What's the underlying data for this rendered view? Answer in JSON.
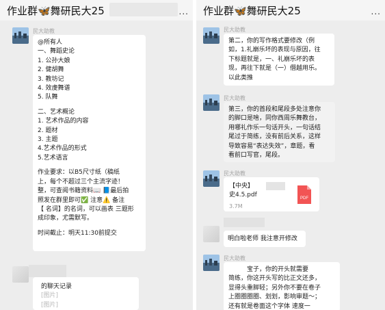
{
  "left": {
    "title": "作业群🦋舞研民大25",
    "more": "...",
    "msg1": {
      "sender": "民大助教",
      "lines": [
        "@所有人",
        "一、舞蹈史论",
        "1. 公孙大娘",
        "2. 健胡舞",
        "3. 教坊记",
        "4. 效虔舞谱",
        "5. 队舞",
        "",
        "二、艺术概论",
        "1. 艺术作品的内容",
        "2. 题材",
        "3. 主题",
        "4.艺术作品的形式",
        "5.艺术语言",
        "",
        "作业要求：以B5尺寸纸（稿纸",
        "上，每个不超过三个主流字迹！",
        "整，可查阅书籍资料📖 📘最后拍",
        "照发在群里即可✅ 注意⚠️ 备注",
        "【 名词】的名词，可以画表 三题形",
        "成印象，尤需默写。",
        "",
        "时间截止：明天11:30前提交"
      ]
    },
    "msg2": {
      "lines": [
        "的聊天记录",
        "[图片]",
        "[图片]"
      ]
    }
  },
  "right": {
    "title": "作业群🦋舞研民大25",
    "more": "...",
    "msg1": {
      "sender": "民大助教",
      "lines": [
        "第二，你的写作格式要修改（例",
        "如，1.礼崩乐坏的表现与原因，往",
        "下标题就是，一、礼崩乐坏的表",
        "现，再往下就是（一）僭越用乐。",
        "以此类推"
      ]
    },
    "msg2": {
      "sender": "民大助教",
      "lines": [
        "第三，你的首段和尾段多处注意你",
        "的脚口是啥，同你西周乐舞教台，",
        "用哪礼作乐一句话开头，一句话结",
        "尾过于简练，没有前后关系，这样",
        "导致容易“表达失效”，章题，看",
        "看前口写官，尾段。"
      ]
    },
    "msg3": {
      "sender": "民大助教",
      "file_name_line1": "【中央】　　　古代",
      "file_name_line2": "史4.5.pdf",
      "file_badge": "PDF",
      "file_size": "3.7M"
    },
    "msg4": {
      "text": "明白啦老师 我注意开修改"
    },
    "msg5": {
      "sender": "民大助教",
      "lines": [
        "　　　宝子，你的开头就需要",
        "简练，你这开头写的比正文还多，",
        "显得头重脚轻；另外你不要在卷子",
        "上圈圈圈圈、划划，影响审题～；",
        "还有就是卷面这个字体 速度一"
      ]
    }
  },
  "colors": {
    "chat_bg": "#ededed",
    "bubble_bg": "#ffffff",
    "pdf_red": "#f25454"
  }
}
